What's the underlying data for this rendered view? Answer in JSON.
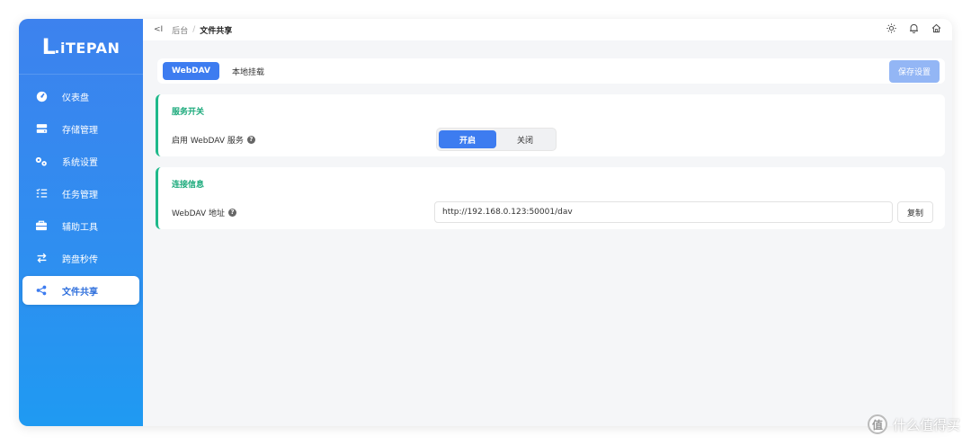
{
  "logo": {
    "mark": "L",
    "text": ".iTEPAN"
  },
  "sidebar": {
    "items": [
      {
        "label": "仪表盘",
        "icon": "dashboard-icon"
      },
      {
        "label": "存储管理",
        "icon": "storage-icon"
      },
      {
        "label": "系统设置",
        "icon": "gears-icon"
      },
      {
        "label": "任务管理",
        "icon": "task-list-icon"
      },
      {
        "label": "辅助工具",
        "icon": "toolbox-icon"
      },
      {
        "label": "跨盘秒传",
        "icon": "transfer-arrows-icon"
      },
      {
        "label": "文件共享",
        "icon": "share-icon",
        "active": true
      }
    ]
  },
  "topbar": {
    "back": "<I",
    "crumb_root": "后台",
    "crumb_sep": "/",
    "crumb_current": "文件共享",
    "icons": [
      "sun-icon",
      "bell-icon",
      "home-icon"
    ]
  },
  "tabs": [
    {
      "label": "WebDAV",
      "active": true
    },
    {
      "label": "本地挂载",
      "active": false
    }
  ],
  "save_label": "保存设置",
  "service": {
    "title": "服务开关",
    "label": "启用 WebDAV 服务",
    "on_label": "开启",
    "off_label": "关闭",
    "state": "on"
  },
  "connection": {
    "title": "连接信息",
    "label": "WebDAV 地址",
    "url": "http://192.168.0.123:50001/dav",
    "copy_label": "复制"
  },
  "watermark": {
    "badge": "值",
    "text": "什么值得买"
  },
  "colors": {
    "accent": "#3d7cf0",
    "section_border": "#1fb98a",
    "section_title": "#19a97a"
  }
}
